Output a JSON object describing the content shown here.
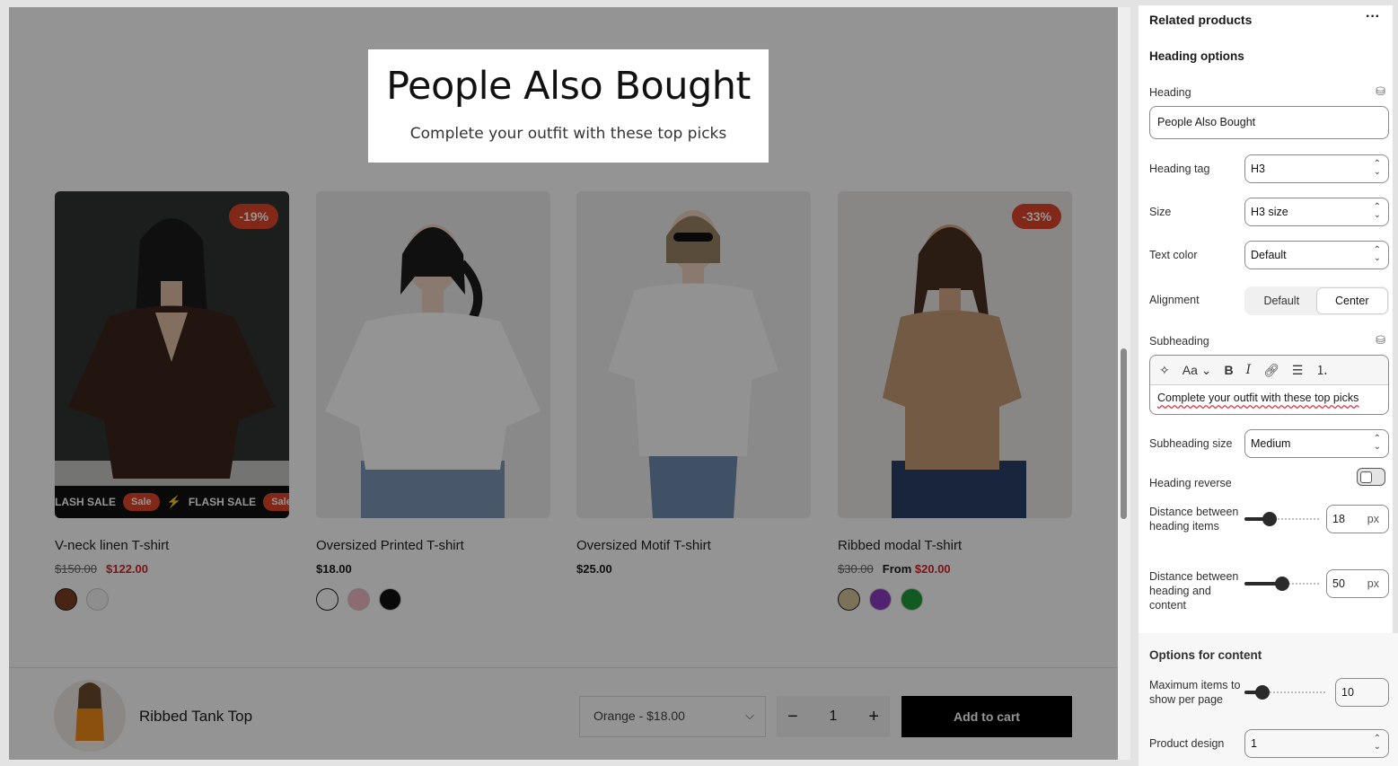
{
  "preview": {
    "heading": "People Also Bought",
    "subheading": "Complete your outfit with these top picks",
    "products": [
      {
        "name": "V-neck linen T-shirt",
        "price_old": "$150.00",
        "price_new": "$122.00",
        "badge": "-19%",
        "swatches": [
          "#7a3e22",
          "#f5f5f5"
        ],
        "marquee": [
          "LASH SALE",
          "Sale",
          "FLASH SALE",
          "Sale"
        ]
      },
      {
        "name": "Oversized Printed T-shirt",
        "price": "$18.00",
        "swatches": [
          "#ffffff",
          "#f2b9c6",
          "#111111"
        ]
      },
      {
        "name": "Oversized Motif T-shirt",
        "price": "$25.00",
        "swatches": []
      },
      {
        "name": "Ribbed modal T-shirt",
        "price_old": "$30.00",
        "price_from_label": "From",
        "price_new": "$20.00",
        "badge": "-33%",
        "swatches": [
          "#d5c49b",
          "#8e3bc2",
          "#1f9c3a"
        ]
      }
    ],
    "sticky_bar": {
      "product_name": "Ribbed Tank Top",
      "variant": "Orange - $18.00",
      "quantity": "1",
      "add_to_cart": "Add to cart"
    }
  },
  "panel": {
    "title": "Related products",
    "more_label": "···",
    "section_heading_options": "Heading options",
    "heading_label": "Heading",
    "heading_value": "People Also Bought",
    "heading_tag_label": "Heading tag",
    "heading_tag_value": "H3",
    "size_label": "Size",
    "size_value": "H3 size",
    "text_color_label": "Text color",
    "text_color_value": "Default",
    "alignment_label": "Alignment",
    "alignment_options": [
      "Default",
      "Center"
    ],
    "alignment_selected": "Center",
    "subheading_label": "Subheading",
    "subheading_value": "Complete your outfit with these top picks",
    "subheading_size_label": "Subheading size",
    "subheading_size_value": "Medium",
    "heading_reverse_label": "Heading reverse",
    "heading_reverse_on": false,
    "distance_items_label": "Distance between heading items",
    "distance_items_value": "18",
    "distance_content_label": "Distance between heading and content",
    "distance_content_value": "50",
    "unit_px": "px",
    "section_content_options": "Options for content",
    "max_items_label": "Maximum items to show per page",
    "max_items_value": "10",
    "product_design_label": "Product design",
    "product_design_value": "1"
  },
  "colors": {
    "accent_red": "#e0452b",
    "sale_price": "#d8232a",
    "button_black": "#000000"
  }
}
